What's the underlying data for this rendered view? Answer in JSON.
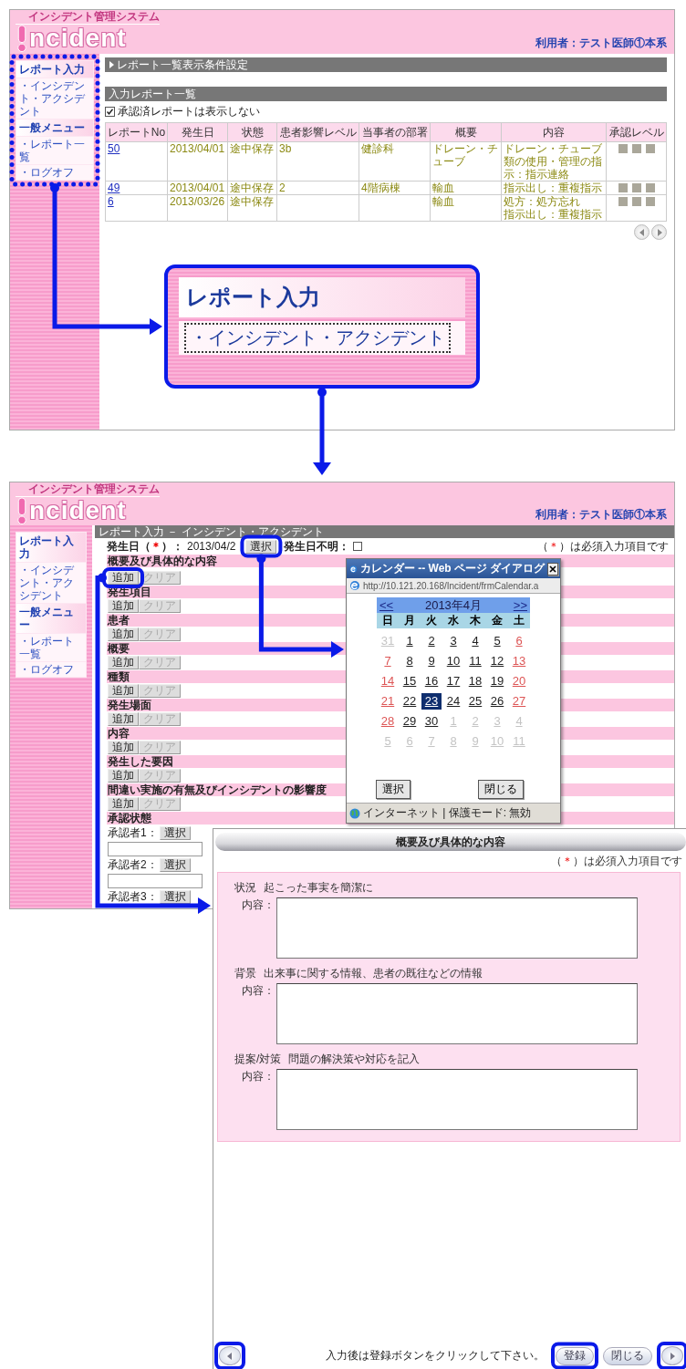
{
  "screen_1": {
    "header": {
      "subtitle": "インシデント管理システム",
      "logo": "ncident",
      "user": "利用者：テスト医師①本系"
    },
    "sidebar": [
      {
        "kind": "heading",
        "label": "レポート入力"
      },
      {
        "kind": "link",
        "label": "・インシデント・アクシデント"
      },
      {
        "kind": "heading",
        "label": "一般メニュー"
      },
      {
        "kind": "link",
        "label": "・レポート一覧"
      },
      {
        "kind": "link",
        "label": "・ログオフ"
      }
    ],
    "filter_bar": "レポート一覧表示条件設定",
    "list_bar": "入力レポート一覧",
    "hide_approved": {
      "label": "承認済レポートは表示しない",
      "checked": true
    },
    "table": {
      "columns": [
        "レポートNo",
        "発生日",
        "状態",
        "患者影響レベル",
        "当事者の部署",
        "概要",
        "内容",
        "承認レベル"
      ],
      "rows": [
        {
          "no": "50",
          "date": "2013/04/01",
          "status": "途中保存",
          "impact_level": "3b",
          "department": "健診科",
          "summary": "ドレーン・チューブ",
          "content": [
            "ドレーン・チューブ類の使用・管理の指示：指示連絡"
          ]
        },
        {
          "no": "49",
          "date": "2013/04/01",
          "status": "途中保存",
          "impact_level": "2",
          "department": "4階病棟",
          "summary": "輸血",
          "content": [
            "指示出し：重複指示"
          ]
        },
        {
          "no": "6",
          "date": "2013/03/26",
          "status": "途中保存",
          "summary": "輸血",
          "content": [
            "処方：処方忘れ",
            "指示出し：重複指示"
          ]
        }
      ]
    }
  },
  "callout": {
    "heading": "レポート入力",
    "item": "・インシデント・アクシデント"
  },
  "screen_2": {
    "header": {
      "subtitle": "インシデント管理システム",
      "logo": "ncident",
      "user": "利用者：テスト医師①本系"
    },
    "sidebar": [
      {
        "kind": "heading",
        "label": "レポート入力"
      },
      {
        "kind": "link",
        "label": "・インシデント・アクシデント"
      },
      {
        "kind": "heading",
        "label": "一般メニュー"
      },
      {
        "kind": "link",
        "label": "・レポート一覧"
      },
      {
        "kind": "link",
        "label": "・ログオフ"
      }
    ],
    "title_bar": "レポート入力 － インシデント・アクシデント",
    "required_note": [
      "（",
      "＊",
      "）は必須入力項目です"
    ],
    "date_field": {
      "label_parts": [
        "発生日（",
        "＊",
        "）："
      ],
      "value": "2013/04/2",
      "button": "選択"
    },
    "unknown_date": {
      "label": "発生日不明：",
      "checked": false
    },
    "sections": [
      {
        "title": "概要及び具体的な内容",
        "add": "追加",
        "clear": "クリア",
        "clear_disabled": true
      },
      {
        "title": "発生項目",
        "add": "追加",
        "clear": "クリア",
        "clear_disabled": true
      },
      {
        "title": "患者",
        "add": "追加",
        "clear": "クリア",
        "clear_disabled": true
      },
      {
        "title": "概要",
        "add": "追加",
        "clear": "クリア",
        "clear_disabled": true
      },
      {
        "title": "種類",
        "add": "追加",
        "clear": "クリア",
        "clear_disabled": true
      },
      {
        "title": "発生場面",
        "add": "追加",
        "clear": "クリア",
        "clear_disabled": true
      },
      {
        "title": "内容",
        "add": "追加",
        "clear": "クリア",
        "clear_disabled": true
      },
      {
        "title": "発生した要因",
        "add": "追加",
        "clear": "クリア",
        "clear_disabled": true
      },
      {
        "title": "間違い実施の有無及びインシデントの影響度",
        "add": "追加",
        "clear": "クリア",
        "clear_disabled": true
      }
    ],
    "approval": {
      "title": "承認状態",
      "approvers": [
        {
          "label": "承認者1：",
          "button": "選択"
        },
        {
          "label": "承認者2：",
          "button": "選択"
        },
        {
          "label": "承認者3：",
          "button": "選択"
        }
      ]
    }
  },
  "calendar": {
    "title": "カレンダー -- Web ページ ダイアログ",
    "url": "http://10.121.20.168/Incident/frmCalendar.a",
    "prev": "<<",
    "month": "2013年4月",
    "next": ">>",
    "weekdays": [
      "日",
      "月",
      "火",
      "水",
      "木",
      "金",
      "土"
    ],
    "days": [
      {
        "label": "31",
        "kind": "other",
        "selected": false
      },
      {
        "label": "1",
        "kind": "normal",
        "selected": false
      },
      {
        "label": "2",
        "kind": "normal",
        "selected": false
      },
      {
        "label": "3",
        "kind": "normal",
        "selected": false
      },
      {
        "label": "4",
        "kind": "normal",
        "selected": false
      },
      {
        "label": "5",
        "kind": "normal",
        "selected": false
      },
      {
        "label": "6",
        "kind": "weekend",
        "selected": false
      },
      {
        "label": "7",
        "kind": "weekend",
        "selected": false
      },
      {
        "label": "8",
        "kind": "normal",
        "selected": false
      },
      {
        "label": "9",
        "kind": "normal",
        "selected": false
      },
      {
        "label": "10",
        "kind": "normal",
        "selected": false
      },
      {
        "label": "11",
        "kind": "normal",
        "selected": false
      },
      {
        "label": "12",
        "kind": "normal",
        "selected": false
      },
      {
        "label": "13",
        "kind": "weekend",
        "selected": false
      },
      {
        "label": "14",
        "kind": "weekend",
        "selected": false
      },
      {
        "label": "15",
        "kind": "normal",
        "selected": false
      },
      {
        "label": "16",
        "kind": "normal",
        "selected": false
      },
      {
        "label": "17",
        "kind": "normal",
        "selected": false
      },
      {
        "label": "18",
        "kind": "normal",
        "selected": false
      },
      {
        "label": "19",
        "kind": "normal",
        "selected": false
      },
      {
        "label": "20",
        "kind": "weekend",
        "selected": false
      },
      {
        "label": "21",
        "kind": "weekend",
        "selected": false
      },
      {
        "label": "22",
        "kind": "normal",
        "selected": false
      },
      {
        "label": "23",
        "kind": "normal",
        "selected": true
      },
      {
        "label": "24",
        "kind": "normal",
        "selected": false
      },
      {
        "label": "25",
        "kind": "normal",
        "selected": false
      },
      {
        "label": "26",
        "kind": "normal",
        "selected": false
      },
      {
        "label": "27",
        "kind": "weekend",
        "selected": false
      },
      {
        "label": "28",
        "kind": "weekend",
        "selected": false
      },
      {
        "label": "29",
        "kind": "normal",
        "selected": false
      },
      {
        "label": "30",
        "kind": "normal",
        "selected": false
      },
      {
        "label": "1",
        "kind": "other",
        "selected": false
      },
      {
        "label": "2",
        "kind": "other",
        "selected": false
      },
      {
        "label": "3",
        "kind": "other",
        "selected": false
      },
      {
        "label": "4",
        "kind": "other",
        "selected": false
      },
      {
        "label": "5",
        "kind": "other",
        "selected": false
      },
      {
        "label": "6",
        "kind": "other",
        "selected": false
      },
      {
        "label": "7",
        "kind": "other",
        "selected": false
      },
      {
        "label": "8",
        "kind": "other",
        "selected": false
      },
      {
        "label": "9",
        "kind": "other",
        "selected": false
      },
      {
        "label": "10",
        "kind": "other",
        "selected": false
      },
      {
        "label": "11",
        "kind": "other",
        "selected": false
      }
    ],
    "buttons": [
      "選択",
      "閉じる"
    ],
    "status": "インターネット | 保護モード: 無効"
  },
  "dialog": {
    "title": "概要及び具体的な内容",
    "required_note": [
      "（",
      "＊",
      "）は必須入力項目です"
    ],
    "fields": [
      {
        "label": "状況",
        "hint": "起こった事実を簡潔に",
        "content_label": "内容："
      },
      {
        "label": "背景",
        "hint": "出来事に関する情報、患者の既往などの情報",
        "content_label": "内容："
      },
      {
        "label": "提案/対策",
        "hint": "問題の解決策や対応を記入",
        "content_label": "内容："
      }
    ],
    "footer": {
      "message": "入力後は登録ボタンをクリックして下さい。",
      "buttons": [
        "登録",
        "閉じる"
      ]
    }
  }
}
